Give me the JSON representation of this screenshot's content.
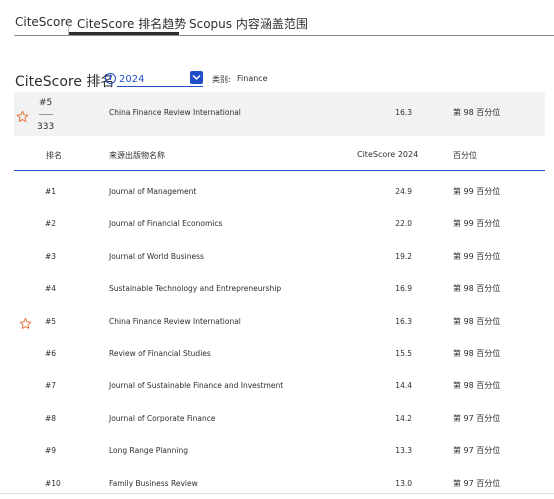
{
  "tabs": [
    "CiteScore",
    "CiteScore 排名趋势",
    "Scopus 内容涵盖范围"
  ],
  "rank_section": {
    "title": "CiteScore 排名",
    "info_icon": "info-icon",
    "year": "2024",
    "category_label": "类别:",
    "category_value": "Finance"
  },
  "highlight": {
    "rank": "#5",
    "total": "333",
    "name": "China Finance Review International",
    "score": "16.3",
    "percentile": "第 98 百分位"
  },
  "columns": [
    "排名",
    "来源出版物名称",
    "CiteScore 2024",
    "百分位"
  ],
  "rows": [
    {
      "rank": "#1",
      "name": "Journal of Management",
      "score": "24.9",
      "percentile": "第 99 百分位",
      "starred": false
    },
    {
      "rank": "#2",
      "name": "Journal of Financial Economics",
      "score": "22.0",
      "percentile": "第 99 百分位",
      "starred": false
    },
    {
      "rank": "#3",
      "name": "Journal of World Business",
      "score": "19.2",
      "percentile": "第 99 百分位",
      "starred": false
    },
    {
      "rank": "#4",
      "name": "Sustainable Technology and Entrepreneurship",
      "score": "16.9",
      "percentile": "第 98 百分位",
      "starred": false
    },
    {
      "rank": "#5",
      "name": "China Finance Review International",
      "score": "16.3",
      "percentile": "第 98 百分位",
      "starred": true
    },
    {
      "rank": "#6",
      "name": "Review of Financial Studies",
      "score": "15.5",
      "percentile": "第 98 百分位",
      "starred": false
    },
    {
      "rank": "#7",
      "name": "Journal of Sustainable Finance and Investment",
      "score": "14.4",
      "percentile": "第 98 百分位",
      "starred": false
    },
    {
      "rank": "#8",
      "name": "Journal of Corporate Finance",
      "score": "14.2",
      "percentile": "第 97 百分位",
      "starred": false
    },
    {
      "rank": "#9",
      "name": "Long Range Planning",
      "score": "13.3",
      "percentile": "第 97 百分位",
      "starred": false
    },
    {
      "rank": "#10",
      "name": "Family Business Review",
      "score": "13.0",
      "percentile": "第 97 百分位",
      "starred": false
    }
  ],
  "colors": {
    "accent": "#1f4ec8",
    "star": "#e8743b",
    "highlight_bg": "#f2f2f2"
  }
}
